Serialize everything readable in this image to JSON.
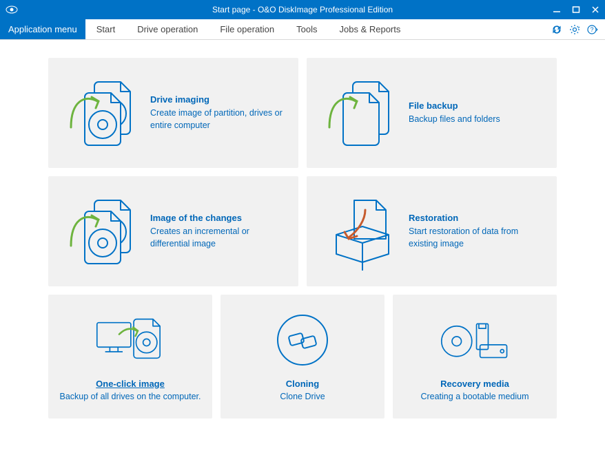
{
  "titlebar": {
    "title": "Start page - O&O DiskImage Professional Edition"
  },
  "menubar": {
    "app_menu": "Application menu",
    "tabs": [
      "Start",
      "Drive operation",
      "File operation",
      "Tools",
      "Jobs & Reports"
    ]
  },
  "cards_top": [
    {
      "title": "Drive imaging",
      "desc": "Create image of partition, drives or entire computer"
    },
    {
      "title": "File backup",
      "desc": "Backup files and folders"
    },
    {
      "title": "Image of the changes",
      "desc": "Creates an incremental or differential image"
    },
    {
      "title": "Restoration",
      "desc": "Start restoration of data from existing image"
    }
  ],
  "cards_bottom": [
    {
      "title": "One-click image",
      "desc": "Backup of all drives on the computer."
    },
    {
      "title": "Cloning",
      "desc": "Clone Drive"
    },
    {
      "title": "Recovery media",
      "desc": "Creating a bootable medium"
    }
  ]
}
